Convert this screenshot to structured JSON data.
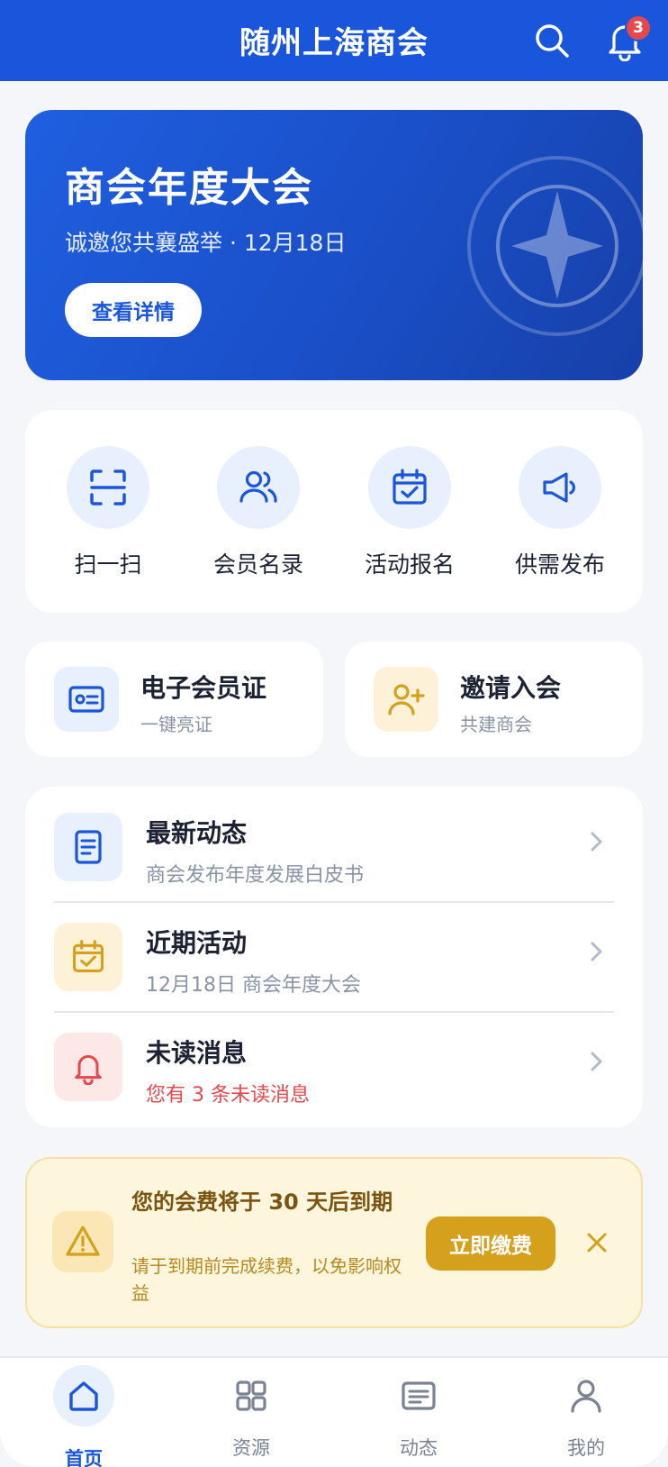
{
  "header": {
    "title": "随州上海商会",
    "notification_count": "3"
  },
  "banner": {
    "title": "商会年度大会",
    "subtitle": "诚邀您共襄盛举 · 12月18日",
    "button_label": "查看详情"
  },
  "quick_actions": [
    {
      "label": "扫一扫",
      "icon": "scan-icon"
    },
    {
      "label": "会员名录",
      "icon": "members-icon"
    },
    {
      "label": "活动报名",
      "icon": "calendar-check-icon"
    },
    {
      "label": "供需发布",
      "icon": "megaphone-icon"
    }
  ],
  "cards": [
    {
      "title": "电子会员证",
      "subtitle": "一键亮证",
      "icon": "id-card-icon"
    },
    {
      "title": "邀请入会",
      "subtitle": "共建商会",
      "icon": "add-user-icon"
    }
  ],
  "list": [
    {
      "title": "最新动态",
      "subtitle": "商会发布年度发展白皮书",
      "icon": "document-icon"
    },
    {
      "title": "近期活动",
      "subtitle": "12月18日 商会年度大会",
      "icon": "calendar-check-icon"
    },
    {
      "title": "未读消息",
      "subtitle": "您有 3 条未读消息",
      "icon": "bell-icon"
    }
  ],
  "notice": {
    "title": "您的会费将于 30 天后到期",
    "subtitle": "请于到期前完成续费，以免影响权益",
    "button_label": "立即缴费"
  },
  "tabs": [
    {
      "label": "首页",
      "icon": "home-icon",
      "active": true
    },
    {
      "label": "资源",
      "icon": "grid-icon"
    },
    {
      "label": "动态",
      "icon": "news-icon"
    },
    {
      "label": "我的",
      "icon": "user-icon"
    }
  ],
  "colors": {
    "primary": "#1a56db",
    "background": "#f4f6fa",
    "warning_bg": "#fef6dc",
    "warning_accent": "#d5a01c",
    "danger": "#e5484d"
  }
}
